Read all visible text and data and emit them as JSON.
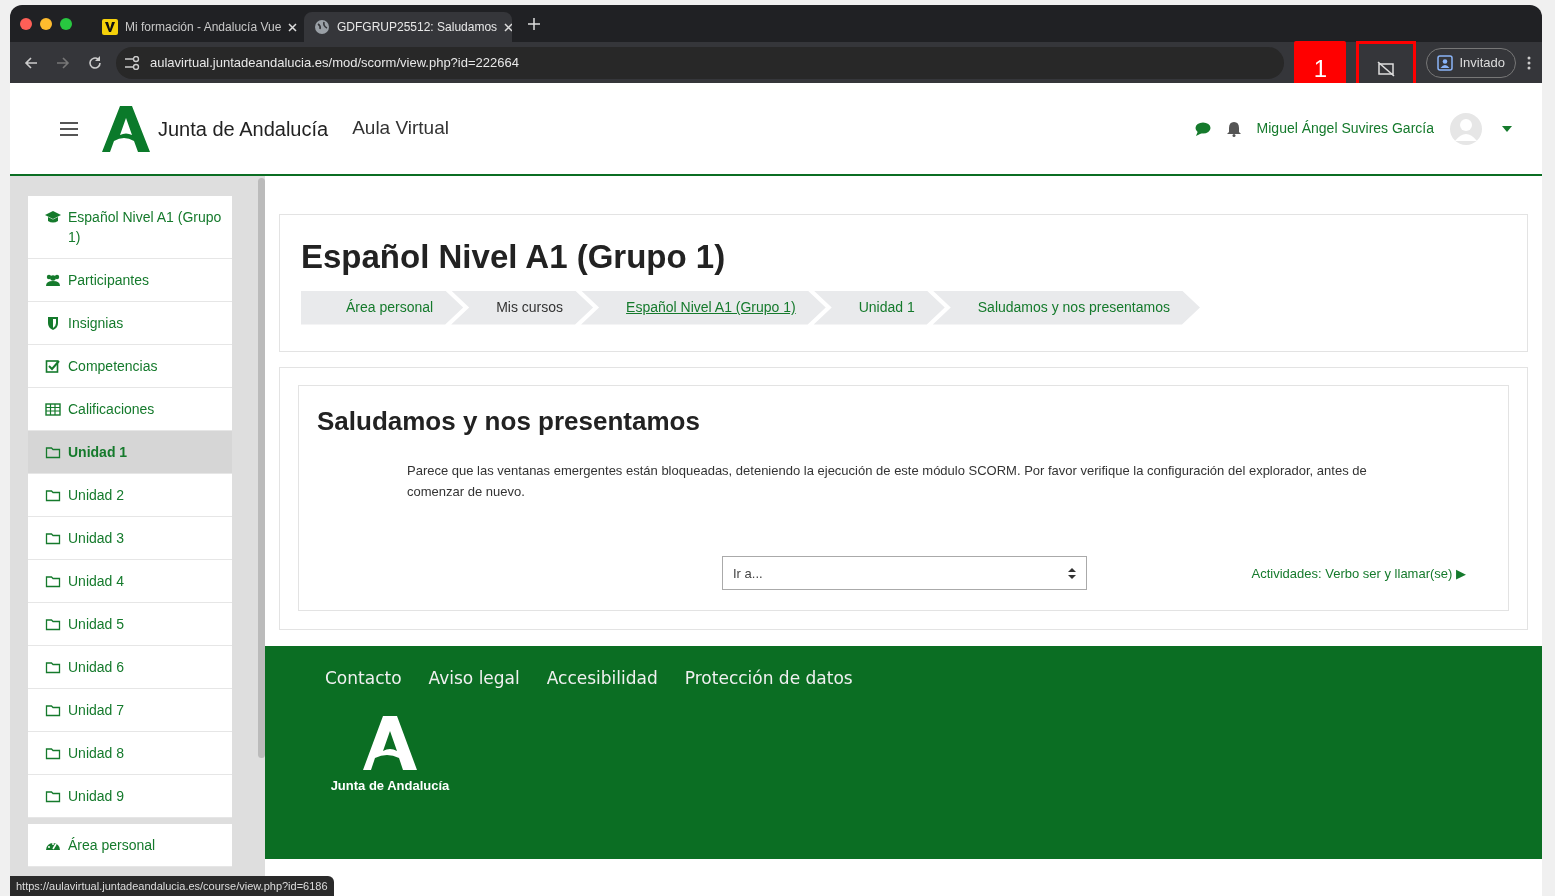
{
  "browser": {
    "tabs": [
      {
        "title": "Mi formación - Andalucía Vue",
        "kind": "vendor",
        "selected": false
      },
      {
        "title": "GDFGRUP25512: Saludamos",
        "kind": "globe",
        "selected": true
      }
    ],
    "url": "aulavirtual.juntadeandalucia.es/mod/scorm/view.php?id=222664",
    "callout": "1",
    "profile": "Invitado",
    "popup_blocked": true
  },
  "header": {
    "brand": "Junta de Andalucía",
    "site": "Aula Virtual",
    "user": "Miguel Ángel Suvires García"
  },
  "sidebar": {
    "groups": [
      [
        {
          "label": "Español Nivel A1 (Grupo 1)",
          "kind": "course",
          "selected": false
        },
        {
          "label": "Participantes",
          "kind": "participants",
          "selected": false
        },
        {
          "label": "Insignias",
          "kind": "badges",
          "selected": false
        },
        {
          "label": "Competencias",
          "kind": "competencies",
          "selected": false
        },
        {
          "label": "Calificaciones",
          "kind": "grades",
          "selected": false
        },
        {
          "label": "Unidad 1",
          "kind": "section",
          "selected": true
        },
        {
          "label": "Unidad 2",
          "kind": "section",
          "selected": false
        },
        {
          "label": "Unidad 3",
          "kind": "section",
          "selected": false
        },
        {
          "label": "Unidad 4",
          "kind": "section",
          "selected": false
        },
        {
          "label": "Unidad 5",
          "kind": "section",
          "selected": false
        },
        {
          "label": "Unidad 6",
          "kind": "section",
          "selected": false
        },
        {
          "label": "Unidad 7",
          "kind": "section",
          "selected": false
        },
        {
          "label": "Unidad 8",
          "kind": "section",
          "selected": false
        },
        {
          "label": "Unidad 9",
          "kind": "section",
          "selected": false
        }
      ],
      [
        {
          "label": "Área personal",
          "kind": "dashboard",
          "selected": false
        }
      ]
    ]
  },
  "course_title": "Español Nivel A1 (Grupo 1)",
  "breadcrumb": [
    {
      "label": "Área personal",
      "link": true,
      "hovered": false
    },
    {
      "label": "Mis cursos",
      "link": false,
      "hovered": false
    },
    {
      "label": "Español Nivel A1 (Grupo 1)",
      "link": true,
      "hovered": true
    },
    {
      "label": "Unidad 1",
      "link": true,
      "hovered": false
    },
    {
      "label": "Saludamos y nos presentamos",
      "link": true,
      "hovered": false
    }
  ],
  "activity": {
    "title": "Saludamos y nos presentamos",
    "message": "Parece que las ventanas emergentes están bloqueadas, deteniendo la ejecución de este módulo SCORM. Por favor verifique la configuración del explorador, antes de comenzar de nuevo.",
    "jump_value": "Ir a...",
    "next_link": "Actividades: Verbo ser y llamar(se) ▶"
  },
  "footer": {
    "links": [
      "Contacto",
      "Aviso legal",
      "Accesibilidad",
      "Protección de datos"
    ],
    "logo_text": "Junta de Andalucía"
  },
  "status_url": "https://aulavirtual.juntadeandalucia.es/course/view.php?id=6186"
}
